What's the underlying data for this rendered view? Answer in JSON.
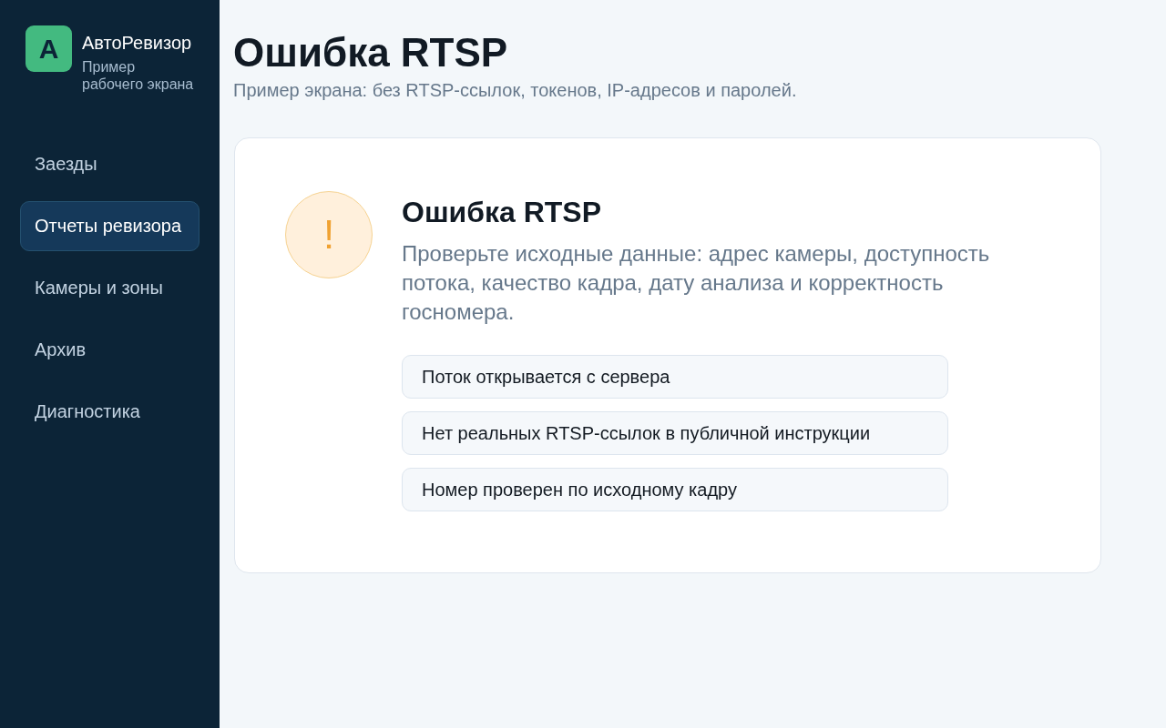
{
  "sidebar": {
    "logo": "A",
    "brand": "АвтоРевизор",
    "tagline": "Пример рабочего экрана",
    "items": [
      {
        "label": "Заезды",
        "selected": false
      },
      {
        "label": "Отчеты ревизора",
        "selected": true
      },
      {
        "label": "Камеры и зоны",
        "selected": false
      },
      {
        "label": "Архив",
        "selected": false
      },
      {
        "label": "Диагностика",
        "selected": false
      }
    ]
  },
  "page": {
    "title": "Ошибка RTSP",
    "subtitle": "Пример экрана: без RTSP-ссылок, токенов, IP-адресов и паролей."
  },
  "card": {
    "icon": "!",
    "title": "Ошибка RTSP",
    "text": "Проверьте исходные данные: адрес камеры, доступность потока, качество кадра, дату анализа и корректность госномера.",
    "checks": [
      "Поток открывается с сервера",
      "Нет реальных RTSP-ссылок в публичной инструкции",
      "Номер проверен по исходному кадру"
    ]
  }
}
